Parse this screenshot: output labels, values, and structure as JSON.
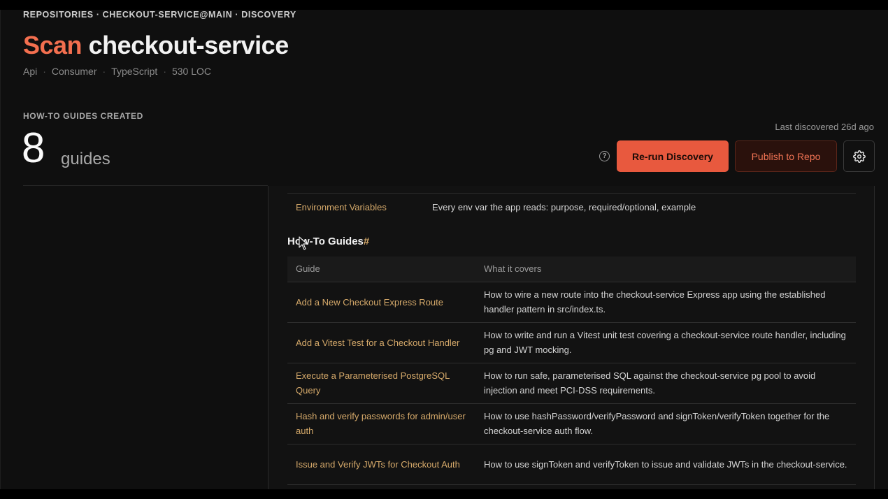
{
  "breadcrumb": "REPOSITORIES · CHECKOUT-SERVICE@MAIN · DISCOVERY",
  "title": {
    "accent": "Scan",
    "name": "checkout-service"
  },
  "meta": [
    "Api",
    "Consumer",
    "TypeScript",
    "530 LOC"
  ],
  "summary": {
    "label": "HOW-TO GUIDES CREATED",
    "count": "8",
    "unit": "guides",
    "last_discovered": "Last discovered 26d ago"
  },
  "actions": {
    "help_icon": "question-circle-icon",
    "rerun": "Re-run Discovery",
    "publish": "Publish to Repo",
    "settings_icon": "gear-icon"
  },
  "doc": {
    "env_row": {
      "name": "Environment Variables",
      "desc": "Every env var the app reads: purpose, required/optional, example"
    },
    "heading": "How-To Guides",
    "heading_anchor": "#",
    "columns": [
      "Guide",
      "What it covers"
    ],
    "rows": [
      {
        "guide": "Add a New Checkout Express Route",
        "covers": "How to wire a new route into the checkout-service Express app using the established handler pattern in src/index.ts."
      },
      {
        "guide": "Add a Vitest Test for a Checkout Handler",
        "covers": "How to write and run a Vitest unit test covering a checkout-service route handler, including pg and JWT mocking."
      },
      {
        "guide": "Execute a Parameterised PostgreSQL Query",
        "covers": "How to run safe, parameterised SQL against the checkout-service pg pool to avoid injection and meet PCI-DSS requirements."
      },
      {
        "guide": "Hash and verify passwords for admin/user auth",
        "covers": "How to use hashPassword/verifyPassword and signToken/verifyToken together for the checkout-service auth flow."
      },
      {
        "guide": "Issue and Verify JWTs for Checkout Auth",
        "covers": "How to use signToken and verifyToken to issue and validate JWTs in the checkout-service."
      }
    ]
  },
  "colors": {
    "accent": "#f36f4f",
    "link": "#d5a96a",
    "primary_button": "#e8593e"
  }
}
